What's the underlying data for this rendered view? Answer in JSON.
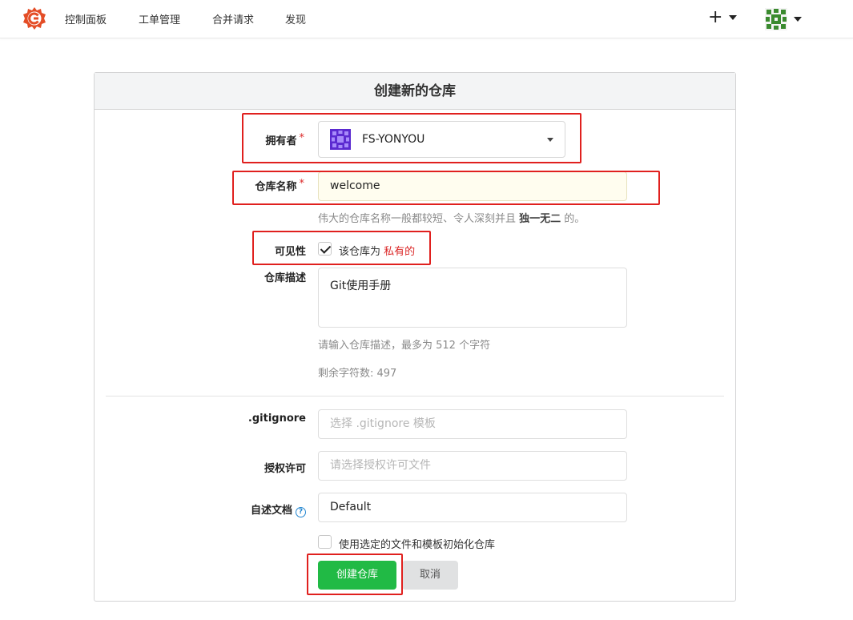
{
  "nav": {
    "logo_icon": "gitea-logo-icon",
    "items": [
      "控制面板",
      "工单管理",
      "合并请求",
      "发现"
    ],
    "create_label": "+",
    "brand_color": "#e44d26"
  },
  "form": {
    "title": "创建新的仓库",
    "owner": {
      "label": "拥有者",
      "required": "*",
      "value": "FS-YONYOU"
    },
    "repo_name": {
      "label": "仓库名称",
      "required": "*",
      "value": "welcome",
      "help_prefix": "伟大的仓库名称一般都较短、令人深刻并且 ",
      "help_bold": "独一无二",
      "help_suffix": " 的。"
    },
    "visibility": {
      "label": "可见性",
      "checked": true,
      "text": "该仓库为 ",
      "highlight": "私有的"
    },
    "description": {
      "label": "仓库描述",
      "value": "Git使用手册",
      "help": "请输入仓库描述，最多为 512 个字符",
      "remaining": "剩余字符数: 497"
    },
    "gitignore": {
      "label": ".gitignore",
      "placeholder": "选择 .gitignore 模板"
    },
    "license": {
      "label": "授权许可",
      "placeholder": "请选择授权许可文件"
    },
    "readme": {
      "label": "自述文档",
      "value": "Default"
    },
    "auto_init": {
      "checked": false,
      "label": "使用选定的文件和模板初始化仓库"
    },
    "submit_label": "创建仓库",
    "cancel_label": "取消"
  },
  "colors": {
    "primary": "#21ba45",
    "required": "#db2828",
    "highlight_box": "#e0201e"
  }
}
